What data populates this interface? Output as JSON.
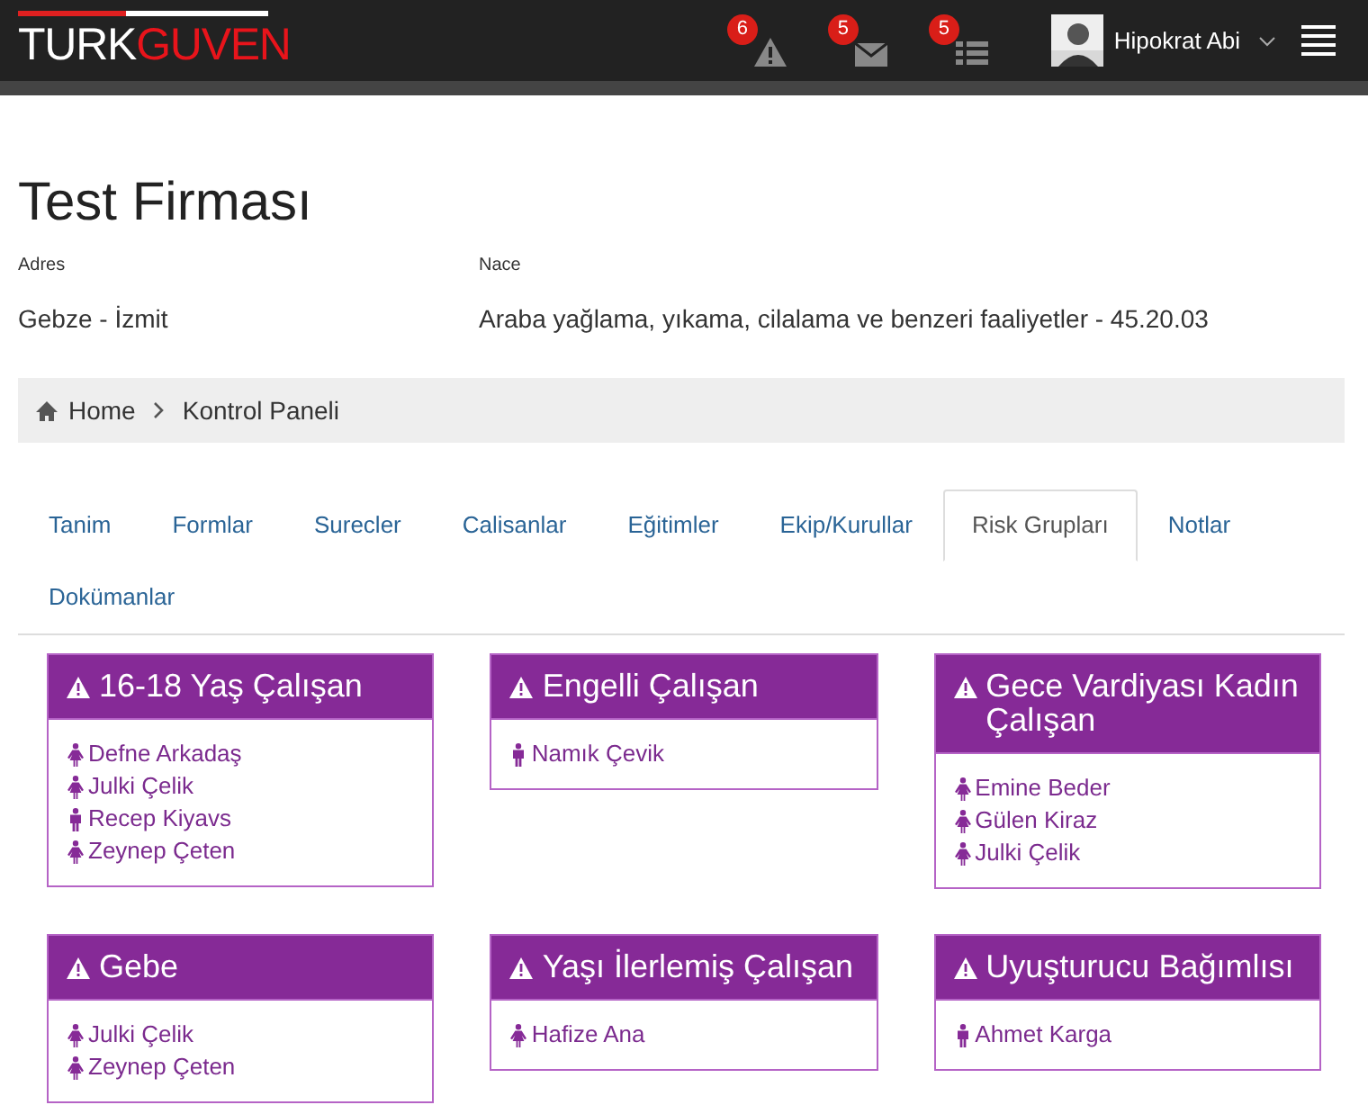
{
  "logo": {
    "first": "TURK",
    "second": "GUVEN"
  },
  "notifications": [
    {
      "kind": "warning",
      "count": "6"
    },
    {
      "kind": "mail",
      "count": "5"
    },
    {
      "kind": "tasks",
      "count": "5"
    }
  ],
  "user": {
    "name": "Hipokrat Abi"
  },
  "page": {
    "title": "Test Firması"
  },
  "fields": [
    {
      "label": "Adres",
      "value": "Gebze - İzmit"
    },
    {
      "label": "Nace",
      "value": "Araba yağlama, yıkama, cilalama ve benzeri faaliyetler - 45.20.03"
    }
  ],
  "breadcrumb": [
    "Home",
    "Kontrol Paneli"
  ],
  "tabs": [
    {
      "label": "Tanim",
      "selected": false
    },
    {
      "label": "Formlar",
      "selected": false
    },
    {
      "label": "Surecler",
      "selected": false
    },
    {
      "label": "Calisanlar",
      "selected": false
    },
    {
      "label": "Eğitimler",
      "selected": false
    },
    {
      "label": "Ekip/Kurullar",
      "selected": false
    },
    {
      "label": "Risk Grupları",
      "selected": true
    },
    {
      "label": "Notlar",
      "selected": false
    },
    {
      "label": "Dokümanlar",
      "selected": false
    }
  ],
  "risk_groups": [
    {
      "title": "16-18 Yaş Çalışan",
      "people": [
        {
          "name": "Defne Arkadaş",
          "kind": "female"
        },
        {
          "name": "Julki Çelik",
          "kind": "female"
        },
        {
          "name": "Recep Kiyavs",
          "kind": "male"
        },
        {
          "name": "Zeynep Çeten",
          "kind": "female"
        }
      ]
    },
    {
      "title": "Engelli Çalışan",
      "people": [
        {
          "name": "Namık Çevik",
          "kind": "male"
        }
      ]
    },
    {
      "title": "Gece Vardiyası Kadın Çalışan",
      "people": [
        {
          "name": "Emine Beder",
          "kind": "female"
        },
        {
          "name": "Gülen Kiraz",
          "kind": "female"
        },
        {
          "name": "Julki Çelik",
          "kind": "female"
        }
      ]
    },
    {
      "title": "Gebe",
      "people": [
        {
          "name": "Julki Çelik",
          "kind": "female"
        },
        {
          "name": "Zeynep Çeten",
          "kind": "female"
        }
      ]
    },
    {
      "title": "Yaşı İlerlemiş Çalışan",
      "people": [
        {
          "name": "Hafize Ana",
          "kind": "female"
        }
      ]
    },
    {
      "title": "Uyuşturucu Bağımlısı",
      "people": [
        {
          "name": "Ahmet Karga",
          "kind": "male"
        }
      ]
    }
  ]
}
